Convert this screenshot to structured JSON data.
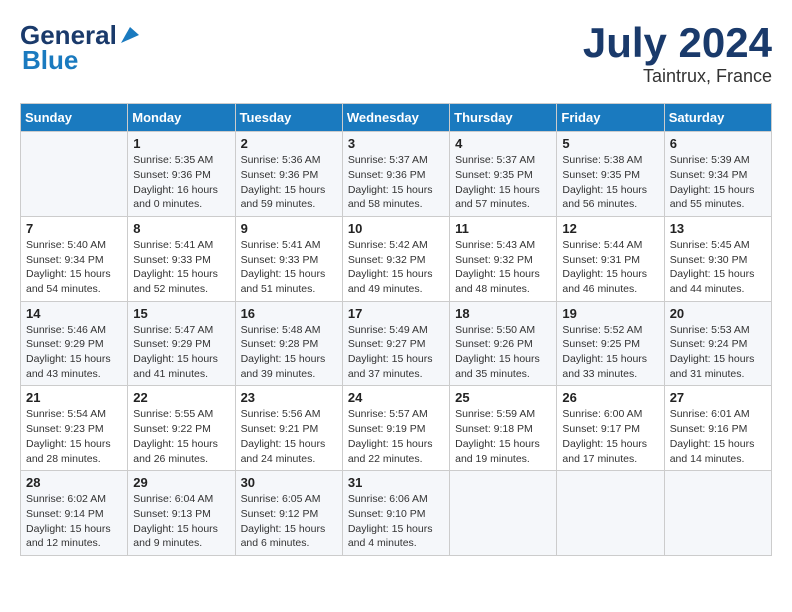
{
  "header": {
    "logo_line1": "General",
    "logo_line2": "Blue",
    "month_title": "July 2024",
    "location": "Taintrux, France"
  },
  "weekdays": [
    "Sunday",
    "Monday",
    "Tuesday",
    "Wednesday",
    "Thursday",
    "Friday",
    "Saturday"
  ],
  "weeks": [
    [
      {
        "day": "",
        "info": ""
      },
      {
        "day": "1",
        "info": "Sunrise: 5:35 AM\nSunset: 9:36 PM\nDaylight: 16 hours\nand 0 minutes."
      },
      {
        "day": "2",
        "info": "Sunrise: 5:36 AM\nSunset: 9:36 PM\nDaylight: 15 hours\nand 59 minutes."
      },
      {
        "day": "3",
        "info": "Sunrise: 5:37 AM\nSunset: 9:36 PM\nDaylight: 15 hours\nand 58 minutes."
      },
      {
        "day": "4",
        "info": "Sunrise: 5:37 AM\nSunset: 9:35 PM\nDaylight: 15 hours\nand 57 minutes."
      },
      {
        "day": "5",
        "info": "Sunrise: 5:38 AM\nSunset: 9:35 PM\nDaylight: 15 hours\nand 56 minutes."
      },
      {
        "day": "6",
        "info": "Sunrise: 5:39 AM\nSunset: 9:34 PM\nDaylight: 15 hours\nand 55 minutes."
      }
    ],
    [
      {
        "day": "7",
        "info": "Sunrise: 5:40 AM\nSunset: 9:34 PM\nDaylight: 15 hours\nand 54 minutes."
      },
      {
        "day": "8",
        "info": "Sunrise: 5:41 AM\nSunset: 9:33 PM\nDaylight: 15 hours\nand 52 minutes."
      },
      {
        "day": "9",
        "info": "Sunrise: 5:41 AM\nSunset: 9:33 PM\nDaylight: 15 hours\nand 51 minutes."
      },
      {
        "day": "10",
        "info": "Sunrise: 5:42 AM\nSunset: 9:32 PM\nDaylight: 15 hours\nand 49 minutes."
      },
      {
        "day": "11",
        "info": "Sunrise: 5:43 AM\nSunset: 9:32 PM\nDaylight: 15 hours\nand 48 minutes."
      },
      {
        "day": "12",
        "info": "Sunrise: 5:44 AM\nSunset: 9:31 PM\nDaylight: 15 hours\nand 46 minutes."
      },
      {
        "day": "13",
        "info": "Sunrise: 5:45 AM\nSunset: 9:30 PM\nDaylight: 15 hours\nand 44 minutes."
      }
    ],
    [
      {
        "day": "14",
        "info": "Sunrise: 5:46 AM\nSunset: 9:29 PM\nDaylight: 15 hours\nand 43 minutes."
      },
      {
        "day": "15",
        "info": "Sunrise: 5:47 AM\nSunset: 9:29 PM\nDaylight: 15 hours\nand 41 minutes."
      },
      {
        "day": "16",
        "info": "Sunrise: 5:48 AM\nSunset: 9:28 PM\nDaylight: 15 hours\nand 39 minutes."
      },
      {
        "day": "17",
        "info": "Sunrise: 5:49 AM\nSunset: 9:27 PM\nDaylight: 15 hours\nand 37 minutes."
      },
      {
        "day": "18",
        "info": "Sunrise: 5:50 AM\nSunset: 9:26 PM\nDaylight: 15 hours\nand 35 minutes."
      },
      {
        "day": "19",
        "info": "Sunrise: 5:52 AM\nSunset: 9:25 PM\nDaylight: 15 hours\nand 33 minutes."
      },
      {
        "day": "20",
        "info": "Sunrise: 5:53 AM\nSunset: 9:24 PM\nDaylight: 15 hours\nand 31 minutes."
      }
    ],
    [
      {
        "day": "21",
        "info": "Sunrise: 5:54 AM\nSunset: 9:23 PM\nDaylight: 15 hours\nand 28 minutes."
      },
      {
        "day": "22",
        "info": "Sunrise: 5:55 AM\nSunset: 9:22 PM\nDaylight: 15 hours\nand 26 minutes."
      },
      {
        "day": "23",
        "info": "Sunrise: 5:56 AM\nSunset: 9:21 PM\nDaylight: 15 hours\nand 24 minutes."
      },
      {
        "day": "24",
        "info": "Sunrise: 5:57 AM\nSunset: 9:19 PM\nDaylight: 15 hours\nand 22 minutes."
      },
      {
        "day": "25",
        "info": "Sunrise: 5:59 AM\nSunset: 9:18 PM\nDaylight: 15 hours\nand 19 minutes."
      },
      {
        "day": "26",
        "info": "Sunrise: 6:00 AM\nSunset: 9:17 PM\nDaylight: 15 hours\nand 17 minutes."
      },
      {
        "day": "27",
        "info": "Sunrise: 6:01 AM\nSunset: 9:16 PM\nDaylight: 15 hours\nand 14 minutes."
      }
    ],
    [
      {
        "day": "28",
        "info": "Sunrise: 6:02 AM\nSunset: 9:14 PM\nDaylight: 15 hours\nand 12 minutes."
      },
      {
        "day": "29",
        "info": "Sunrise: 6:04 AM\nSunset: 9:13 PM\nDaylight: 15 hours\nand 9 minutes."
      },
      {
        "day": "30",
        "info": "Sunrise: 6:05 AM\nSunset: 9:12 PM\nDaylight: 15 hours\nand 6 minutes."
      },
      {
        "day": "31",
        "info": "Sunrise: 6:06 AM\nSunset: 9:10 PM\nDaylight: 15 hours\nand 4 minutes."
      },
      {
        "day": "",
        "info": ""
      },
      {
        "day": "",
        "info": ""
      },
      {
        "day": "",
        "info": ""
      }
    ]
  ]
}
